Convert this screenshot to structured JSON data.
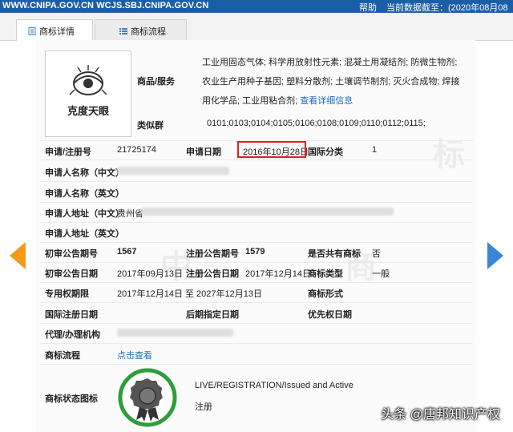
{
  "topbar": {
    "site_text": "WWW.CNIPA.GOV.CN WCJS.SBJ.CNIPA.GOV.CN",
    "help_label": "帮助",
    "data_date": "当前数据截至：(2020年08月08日)"
  },
  "tabs": [
    {
      "label": "商标详情",
      "icon": "document-icon",
      "active": true
    },
    {
      "label": "商标流程",
      "icon": "list-icon",
      "active": false
    }
  ],
  "trademark": {
    "logo_text": "克度天眼",
    "goods_label": "商品/服务",
    "goods_text": "工业用固态气体; 科学用放射性元素; 混凝土用凝结剂; 防微生物剂; 农业生产用种子基因; 塑料分散剂; 土壤调节制剂; 灭火合成物; 焊接用化学品; 工业用粘合剂;",
    "goods_more": "查看详细信息",
    "similar_group_label": "类似群",
    "similar_group_value": "0101;0103;0104;0105;0106;0108;0109;0110;0112;0115;",
    "reg_no_label": "申请/注册号",
    "reg_no_value": "21725174",
    "apply_date_label": "申请日期",
    "apply_date_value": "2016年10月28日",
    "intl_class_label": "国际分类",
    "intl_class_value": "1",
    "applicant_cn_label": "申请人名称（中文）",
    "applicant_en_label": "申请人名称（英文）",
    "address_cn_label": "申请人地址（中文）",
    "address_cn_prefix": "贵州省",
    "address_en_label": "申请人地址（英文）",
    "prelim_no_label": "初审公告期号",
    "prelim_no_value": "1567",
    "reg_pub_no_label": "注册公告期号",
    "reg_pub_no_value": "1579",
    "shared_label": "是否共有商标",
    "shared_value": "否",
    "prelim_date_label": "初审公告日期",
    "prelim_date_value": "2017年09月13日",
    "reg_pub_date_label": "注册公告日期",
    "reg_pub_date_value": "2017年12月14日",
    "tm_type_label": "商标类型",
    "tm_type_value": "一般",
    "exclusive_label": "专用权期限",
    "exclusive_value": "2017年12月14日 至 2027年12月13日",
    "tm_form_label": "商标形式",
    "intl_reg_date_label": "国际注册日期",
    "later_date_label": "后期指定日期",
    "priority_date_label": "优先权日期",
    "agent_label": "代理/办理机构",
    "process_label": "商标流程",
    "process_link": "点击查看",
    "status_icon_label": "商标状态图标",
    "status_en": "LIVE/REGISTRATION/Issued and Active",
    "status_cn": "注册"
  },
  "watermark_text": "头条 @唐邦知识产权",
  "colors": {
    "topbar": "#1b5ea8",
    "link": "#1f6cc0",
    "highlight": "#e02020",
    "arrow_left": "#f39a1d",
    "arrow_right": "#3a86d6",
    "status_ring": "#2e9e3a"
  }
}
